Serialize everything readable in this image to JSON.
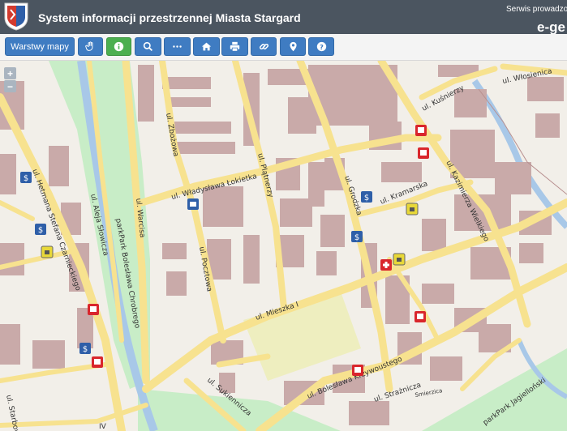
{
  "header": {
    "title": "System informacji przestrzennej Miasta Stargard",
    "service_text": "Serwis prowadzon",
    "brand": "e-ge"
  },
  "toolbar": {
    "layers_label": "Warstwy mapy",
    "icons": [
      "hand-icon",
      "info-icon",
      "search-icon",
      "more-icon",
      "home-icon",
      "print-icon",
      "link-icon",
      "location-pin-icon",
      "help-icon"
    ]
  },
  "map": {
    "zoom_in": "+",
    "zoom_out": "−",
    "streets": {
      "wloszczenica": "ul. Włosienica",
      "kusnierzy": "ul. Kuśnierzy",
      "zbozowa": "ul. Zbożowa",
      "lokietka": "ul. Władysława Łokietka",
      "plociow": "ul. Plątnerzy",
      "grodzka": "ul. Grodzka",
      "kramarska": "ul. Kramarska",
      "wielkiego": "ul. Kazimierza Wielkiego",
      "hetmana": "ul. Hetmana Stefana Czarnieckiego",
      "slowicza": "ul. Aleja Słowicza",
      "chrobrego": "parkPark Bolesława Chrobrego",
      "warcisa": "ul. Warcisa",
      "pocztowa": "ul. Pocztowa",
      "mieszka": "ul. Mieszka I",
      "sukiennicza": "ul. Sukiennicza",
      "krzywoustego": "ul. Bolesława Krzywoustego",
      "straznicza": "ul. Strażnicza",
      "jagiellonski": "parkPark Jagielloński",
      "starbowa": "ul. Starbowa",
      "iv": "IV",
      "smierzica": "Smierzica"
    }
  },
  "colors": {
    "header_bg": "#4b5560",
    "button_blue": "#3f7cc2",
    "button_green": "#4caf50",
    "road": "#f7e28f",
    "building": "#c9aaa9",
    "park": "#c8edc7"
  }
}
